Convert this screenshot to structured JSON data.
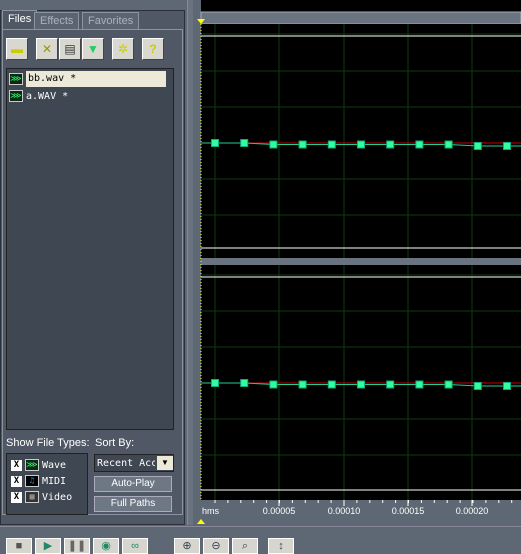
{
  "tabs": [
    {
      "label": "Files"
    },
    {
      "label": "Effects"
    },
    {
      "label": "Favorites"
    }
  ],
  "toolbar": [
    {
      "icon": "open-folder-icon"
    },
    {
      "icon": "close-file-icon"
    },
    {
      "icon": "insert-multitrack-icon"
    },
    {
      "icon": "edit-waveform-icon"
    },
    {
      "icon": "options-icon"
    },
    {
      "icon": "help-icon"
    }
  ],
  "files": [
    {
      "name": "bb.wav *",
      "selected": true
    },
    {
      "name": "a.WAV *",
      "selected": false
    }
  ],
  "show_file_types": {
    "label": "Show File Types:",
    "items": [
      {
        "label": "Wave",
        "checked": true
      },
      {
        "label": "MIDI",
        "checked": true
      },
      {
        "label": "Video",
        "checked": true
      }
    ]
  },
  "sort_by": {
    "label": "Sort By:",
    "value": "Recent Acc"
  },
  "buttons": {
    "auto_play": "Auto-Play",
    "full_paths": "Full Paths"
  },
  "ruler": {
    "unit": "hms",
    "ticks": [
      "0.00005",
      "0.00010",
      "0.00015",
      "0.00020"
    ]
  },
  "colors": {
    "waveform_bg": "#000000",
    "grid": "#0f3a0f",
    "sample_point": "#33ff99",
    "line_red": "#cc0000",
    "cursor": "#ffff00"
  },
  "transport": [
    "stop",
    "play",
    "pause",
    "play-from-cursor",
    "loop"
  ],
  "zoom_tools": [
    "zoom-in",
    "zoom-out",
    "zoom-selection",
    "zoom-vertical"
  ]
}
